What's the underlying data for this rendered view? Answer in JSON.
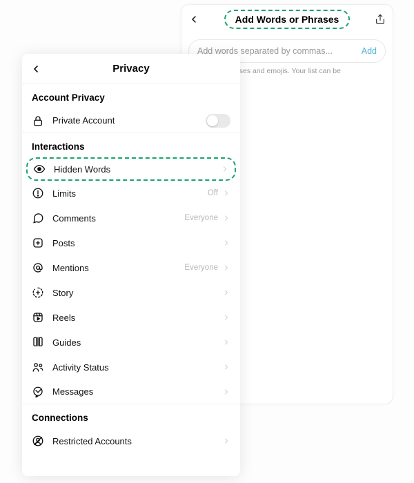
{
  "back_panel": {
    "title": "Add Words or Phrases",
    "input_placeholder": "Add words separated by commas...",
    "add_label": "Add",
    "helper_text": "ble words, phrases and emojis. Your list can be"
  },
  "front_panel": {
    "title": "Privacy",
    "sections": {
      "account_privacy": "Account Privacy",
      "interactions": "Interactions",
      "connections": "Connections"
    },
    "rows": {
      "private_account": {
        "label": "Private Account"
      },
      "hidden_words": {
        "label": "Hidden Words"
      },
      "limits": {
        "label": "Limits",
        "value": "Off"
      },
      "comments": {
        "label": "Comments",
        "value": "Everyone"
      },
      "posts": {
        "label": "Posts"
      },
      "mentions": {
        "label": "Mentions",
        "value": "Everyone"
      },
      "story": {
        "label": "Story"
      },
      "reels": {
        "label": "Reels"
      },
      "guides": {
        "label": "Guides"
      },
      "activity_status": {
        "label": "Activity Status"
      },
      "messages": {
        "label": "Messages"
      },
      "restricted": {
        "label": "Restricted Accounts"
      }
    }
  }
}
